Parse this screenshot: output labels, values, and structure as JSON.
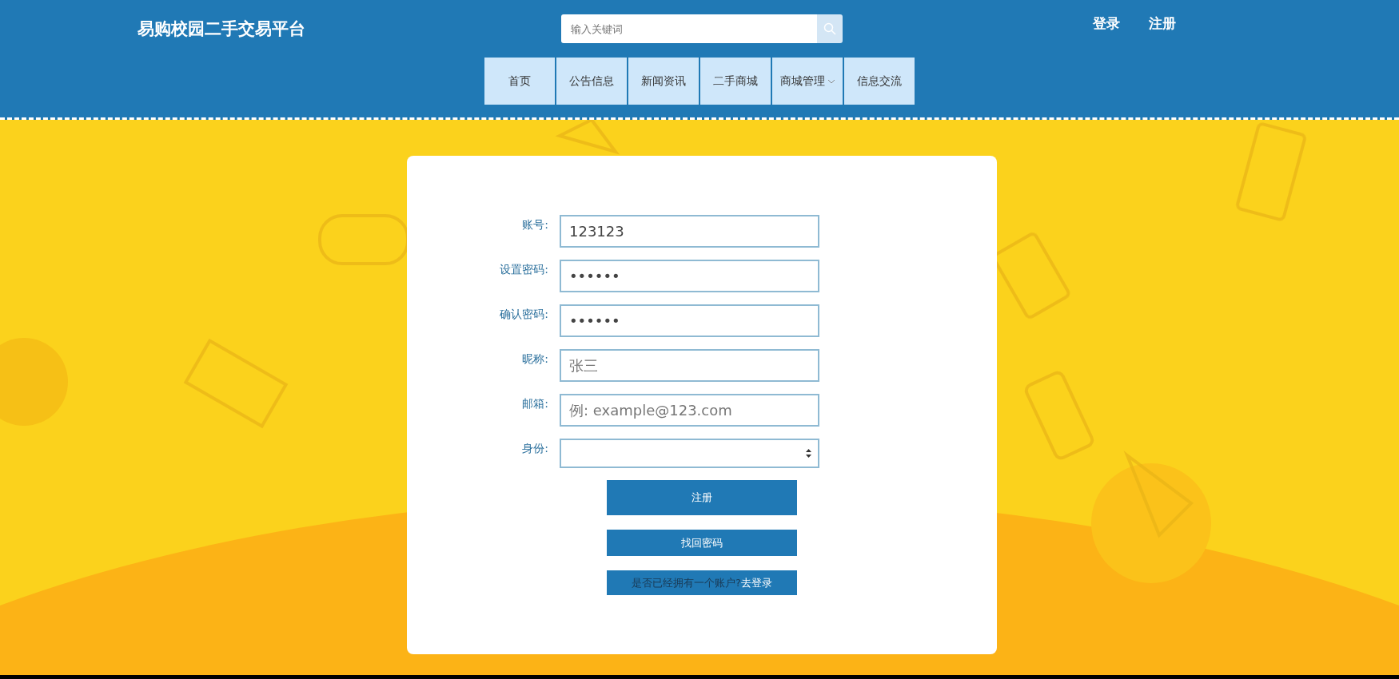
{
  "header": {
    "title": "易购校园二手交易平台",
    "search": {
      "placeholder": "输入关键词"
    },
    "auth_links": [
      "登录",
      "注册"
    ]
  },
  "nav": [
    {
      "label": "首页",
      "has_dropdown": false
    },
    {
      "label": "公告信息",
      "has_dropdown": false
    },
    {
      "label": "新闻资讯",
      "has_dropdown": false
    },
    {
      "label": "二手商城",
      "has_dropdown": false
    },
    {
      "label": "商城管理",
      "has_dropdown": true
    },
    {
      "label": "信息交流",
      "has_dropdown": false
    }
  ],
  "form": {
    "fields": [
      {
        "kind": "text",
        "label": "账号:",
        "value": "123123"
      },
      {
        "kind": "password",
        "label": "设置密码:",
        "value": "••••••"
      },
      {
        "kind": "password",
        "label": "确认密码:",
        "value": "••••••"
      },
      {
        "kind": "text",
        "label": "昵称:",
        "placeholder": "张三"
      },
      {
        "kind": "text",
        "label": "邮箱:",
        "placeholder": "例: example@123.com"
      },
      {
        "kind": "select",
        "label": "身份:"
      }
    ],
    "register_button": "注册",
    "recover_button": "找回密码",
    "login_prompt": {
      "text": "是否已经拥有一个账户?",
      "link": "去登录"
    }
  }
}
